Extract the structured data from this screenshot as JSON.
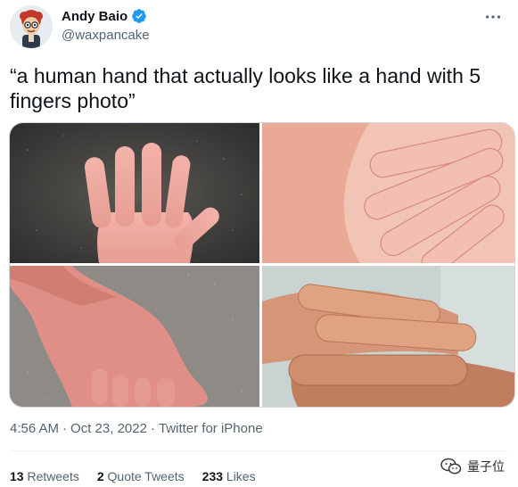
{
  "author": {
    "display_name": "Andy Baio",
    "handle": "@waxpancake",
    "verified": true,
    "avatar_icon": "cartoon-avatar-icon"
  },
  "more_icon": "more-dots-icon",
  "tweet": {
    "text": "“a human hand that actually looks like a hand with 5 fingers photo”"
  },
  "media": [
    {
      "icon": "photo-open-palm-asphalt"
    },
    {
      "icon": "photo-hands-closeup"
    },
    {
      "icon": "photo-hand-gravel"
    },
    {
      "icon": "photo-fingers-closeup"
    }
  ],
  "meta": {
    "time": "4:56 AM",
    "separator1": "·",
    "date": "Oct 23, 2022",
    "separator2": "·",
    "source": "Twitter for iPhone"
  },
  "stats": {
    "retweets_count": "13",
    "retweets_label": "Retweets",
    "quote_count": "2",
    "quote_label": "Quote Tweets",
    "likes_count": "233",
    "likes_label": "Likes"
  },
  "watermark": {
    "text": "量子位",
    "icon": "wechat-icon"
  },
  "colors": {
    "text_primary": "#0f1419",
    "text_secondary": "#536471",
    "verified_blue": "#1d9bf0",
    "border": "#cfd9de"
  }
}
